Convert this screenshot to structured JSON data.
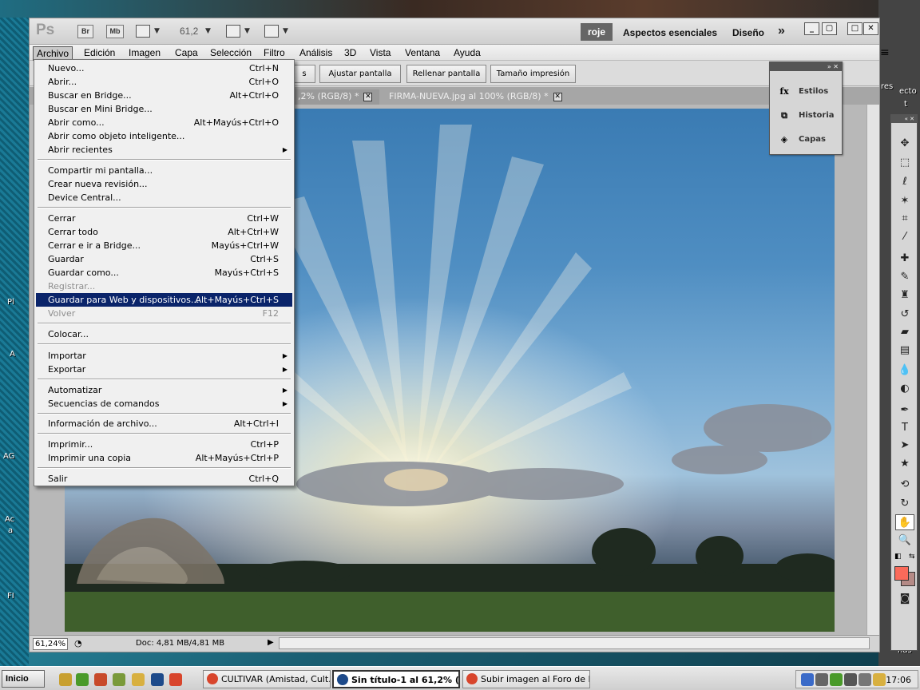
{
  "app": {
    "logo": "Ps",
    "bridge": "Br",
    "minibridge": "Mb",
    "zoom": "61,2",
    "workspace_active": "roje",
    "workspaces": [
      "Aspectos esenciales",
      "Diseño"
    ],
    "more": "»"
  },
  "menubar": [
    "Archivo",
    "Edición",
    "Imagen",
    "Capa",
    "Selección",
    "Filtro",
    "Análisis",
    "3D",
    "Vista",
    "Ventana",
    "Ayuda"
  ],
  "options": {
    "partial": "s",
    "fit_screen": "Ajustar pantalla",
    "fill_screen": "Rellenar pantalla",
    "print_size": "Tamaño impresión"
  },
  "tabs": [
    {
      "label": ",2% (RGB/8) *"
    },
    {
      "label": "FIRMA-NUEVA.jpg al 100% (RGB/8) *"
    }
  ],
  "file_menu": [
    {
      "label": "Nuevo...",
      "shortcut": "Ctrl+N"
    },
    {
      "label": "Abrir...",
      "shortcut": "Ctrl+O"
    },
    {
      "label": "Buscar en Bridge...",
      "shortcut": "Alt+Ctrl+O"
    },
    {
      "label": "Buscar en Mini Bridge...",
      "shortcut": ""
    },
    {
      "label": "Abrir como...",
      "shortcut": "Alt+Mayús+Ctrl+O"
    },
    {
      "label": "Abrir como objeto inteligente...",
      "shortcut": ""
    },
    {
      "label": "Abrir recientes",
      "shortcut": "",
      "submenu": true
    },
    {
      "label": "Compartir mi pantalla...",
      "shortcut": ""
    },
    {
      "label": "Crear nueva revisión...",
      "shortcut": ""
    },
    {
      "label": "Device Central...",
      "shortcut": ""
    },
    {
      "label": "Cerrar",
      "shortcut": "Ctrl+W"
    },
    {
      "label": "Cerrar todo",
      "shortcut": "Alt+Ctrl+W"
    },
    {
      "label": "Cerrar e ir a Bridge...",
      "shortcut": "Mayús+Ctrl+W"
    },
    {
      "label": "Guardar",
      "shortcut": "Ctrl+S"
    },
    {
      "label": "Guardar como...",
      "shortcut": "Mayús+Ctrl+S"
    },
    {
      "label": "Registrar...",
      "shortcut": "",
      "disabled": true
    },
    {
      "label": "Guardar para Web y dispositivos...",
      "shortcut": "Alt+Mayús+Ctrl+S",
      "highlighted": true
    },
    {
      "label": "Volver",
      "shortcut": "F12",
      "disabled": true
    },
    {
      "label": "Colocar...",
      "shortcut": ""
    },
    {
      "label": "Importar",
      "shortcut": "",
      "submenu": true
    },
    {
      "label": "Exportar",
      "shortcut": "",
      "submenu": true
    },
    {
      "label": "Automatizar",
      "shortcut": "",
      "submenu": true
    },
    {
      "label": "Secuencias de comandos",
      "shortcut": "",
      "submenu": true
    },
    {
      "label": "Información de archivo...",
      "shortcut": "Alt+Ctrl+I"
    },
    {
      "label": "Imprimir...",
      "shortcut": "Ctrl+P"
    },
    {
      "label": "Imprimir una copia",
      "shortcut": "Alt+Mayús+Ctrl+P"
    },
    {
      "label": "Salir",
      "shortcut": "Ctrl+Q"
    }
  ],
  "panel": [
    {
      "label": "Estilos",
      "icon": "fx-icon",
      "glyph": "fx"
    },
    {
      "label": "Historia",
      "icon": "history-icon",
      "glyph": "⧉"
    },
    {
      "label": "Capas",
      "icon": "layers-icon",
      "glyph": "◈"
    }
  ],
  "status": {
    "zoom": "61,24%",
    "doc": "Doc: 4,81 MB/4,81 MB"
  },
  "taskbar": {
    "start": "Inicio",
    "tasks": [
      {
        "label": "CULTIVAR (Amistad, Cult...",
        "icon": "chrome-icon",
        "color": "#d8452c"
      },
      {
        "label": "Sin título-1 al 61,2% (...",
        "icon": "photoshop-icon",
        "color": "#1d4a8a",
        "active": true
      },
      {
        "label": "Subir imagen al Foro de I...",
        "icon": "chrome-icon",
        "color": "#d8452c"
      }
    ],
    "clock": "17:06"
  },
  "desktop_labels": [
    "Pl",
    "A",
    "AG",
    "Ac",
    "a",
    "FI",
    "res",
    "ecto",
    "t",
    "nas"
  ],
  "colors": {
    "foreground": "#fa6a5a",
    "background": "#b48a86",
    "highlight": "#0a246a"
  }
}
